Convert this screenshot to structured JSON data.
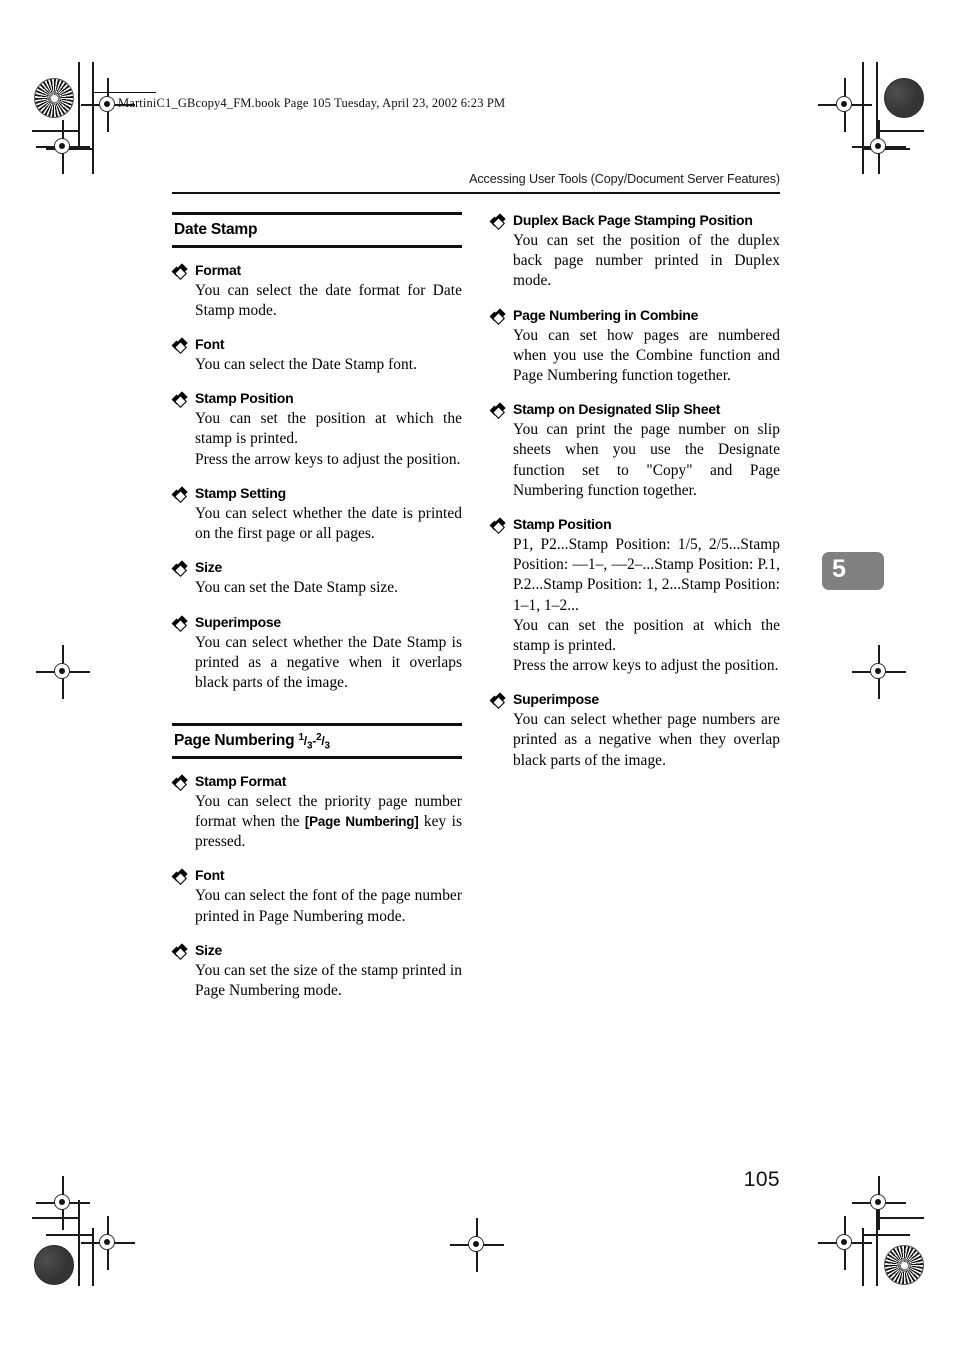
{
  "meta": {
    "file_stamp": "MartiniC1_GBcopy4_FM.book  Page 105  Tuesday, April 23, 2002  6:23 PM",
    "running_head": "Accessing User Tools (Copy/Document Server Features)",
    "chapter_tab": "5",
    "folio": "105",
    "tab_color": "#808080"
  },
  "left_column": {
    "sections": [
      {
        "heading": "Date Stamp",
        "heading_suffix_num1": "",
        "heading_suffix_den1": "",
        "heading_suffix_num2": "",
        "heading_suffix_den2": "",
        "items": [
          {
            "title": "Format",
            "paragraphs": [
              "You can select the date format for Date Stamp mode."
            ]
          },
          {
            "title": "Font",
            "paragraphs": [
              "You can select the Date Stamp font."
            ]
          },
          {
            "title": "Stamp Position",
            "paragraphs": [
              "You can set the position at which the stamp is printed.",
              "Press the arrow keys to adjust the position."
            ]
          },
          {
            "title": "Stamp Setting",
            "paragraphs": [
              "You can select whether the date is printed on the first page or all pages."
            ]
          },
          {
            "title": "Size",
            "paragraphs": [
              "You can set the Date Stamp size."
            ]
          },
          {
            "title": "Superimpose",
            "paragraphs": [
              "You can select whether the Date Stamp is printed as a negative when it overlaps black parts of the image."
            ]
          }
        ]
      },
      {
        "heading": "Page Numbering ",
        "heading_suffix_num1": "1",
        "heading_suffix_den1": "3",
        "heading_suffix_sep": "-",
        "heading_suffix_num2": "2",
        "heading_suffix_den2": "3",
        "items": [
          {
            "title": "Stamp Format",
            "paragraph_pre": "You can select the priority page number format when the ",
            "paragraph_key": "[Page Numbering]",
            "paragraph_post": " key is pressed."
          },
          {
            "title": "Font",
            "paragraphs": [
              "You can select the font of the page number printed in Page Numbering mode."
            ]
          },
          {
            "title": "Size",
            "paragraphs": [
              "You can set the size of the stamp printed in Page Numbering mode."
            ]
          }
        ]
      }
    ]
  },
  "right_column": {
    "items": [
      {
        "title": "Duplex Back Page Stamping Position",
        "paragraphs": [
          "You can set the position of the duplex back page number printed in Duplex mode."
        ]
      },
      {
        "title": "Page Numbering in Combine",
        "paragraphs": [
          "You can set how pages are numbered when you use the Combine function and Page Numbering function together."
        ]
      },
      {
        "title": "Stamp on Designated Slip Sheet",
        "paragraphs": [
          "You can print the page number on slip sheets when you use the Designate function set to \"Copy\" and Page Numbering function together."
        ]
      },
      {
        "title": "Stamp Position",
        "paragraphs": [
          "P1, P2...Stamp Position: 1/5, 2/5...Stamp Position: —1–, —2–...Stamp Position: P.1, P.2...Stamp Position: 1, 2...Stamp Position: 1–1, 1–2...",
          "You can set the position at which the stamp is printed.",
          "Press the arrow keys to adjust the position."
        ]
      },
      {
        "title": "Superimpose",
        "paragraphs": [
          "You can select whether page numbers are printed as a negative when they overlap black parts of the image."
        ]
      }
    ]
  }
}
